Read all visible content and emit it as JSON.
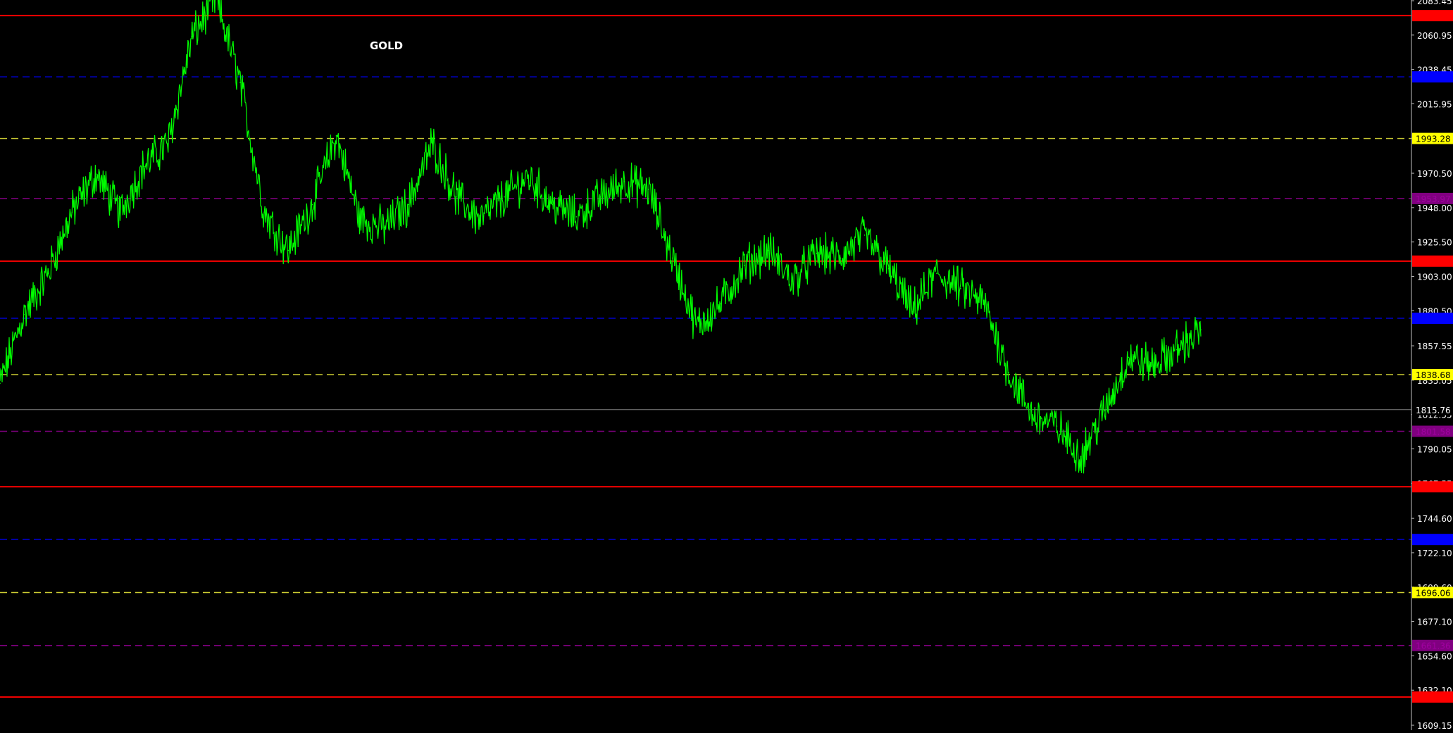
{
  "chart_data": {
    "type": "line",
    "title": "GOLD",
    "xlabel": "",
    "ylabel": "",
    "ylim": [
      1609.15,
      2083.45
    ],
    "grid": false,
    "colors": {
      "background": "#000000",
      "price_line": "#00ff00",
      "axis_text": "#ffffff",
      "axis_line": "#c0c0c0",
      "current_price_line": "#808080"
    },
    "y_tick_labels": [
      "2083.45",
      "2060.95",
      "2038.45",
      "2015.95",
      "1993.45",
      "1970.50",
      "1948.00",
      "1925.50",
      "1903.00",
      "1880.50",
      "1857.55",
      "1835.05",
      "1812.55",
      "1790.05",
      "1767.55",
      "1744.60",
      "1722.10",
      "1699.60",
      "1677.10",
      "1654.60",
      "1632.10",
      "1609.15"
    ],
    "current_price": {
      "label": "1815.76",
      "value": 1815.76,
      "bg": "#000000",
      "fg": "#ffffff"
    },
    "level_lines": [
      {
        "label": "2073.70",
        "value": 2073.7,
        "color": "#ff0000",
        "fg": "#ff0000",
        "bg": "#ff0000",
        "style": "solid"
      },
      {
        "label": "2033.59",
        "value": 2033.59,
        "color": "#0000cc",
        "fg": "#0000ff",
        "bg": "#0000ff",
        "style": "dashed"
      },
      {
        "label": "1993.28",
        "value": 1993.28,
        "color": "#cccc33",
        "fg": "#000000",
        "bg": "#ffff00",
        "style": "dashed"
      },
      {
        "label": "1953.97",
        "value": 1953.97,
        "color": "#800080",
        "fg": "#a000a0",
        "bg": "#800080",
        "style": "dashed"
      },
      {
        "label": "1912.98",
        "value": 1912.98,
        "color": "#ff0000",
        "fg": "#ff0000",
        "bg": "#ff0000",
        "style": "solid"
      },
      {
        "label": "1875.57",
        "value": 1875.57,
        "color": "#0000cc",
        "fg": "#0000ff",
        "bg": "#0000ff",
        "style": "dashed"
      },
      {
        "label": "1838.68",
        "value": 1838.68,
        "color": "#cccc33",
        "fg": "#000000",
        "bg": "#ffff00",
        "style": "dashed"
      },
      {
        "label": "1801.58",
        "value": 1801.58,
        "color": "#800080",
        "fg": "#a000a0",
        "bg": "#800080",
        "style": "dashed"
      },
      {
        "label": "1765.29",
        "value": 1765.29,
        "color": "#ff0000",
        "fg": "#ff0000",
        "bg": "#ff0000",
        "style": "solid"
      },
      {
        "label": "1730.76",
        "value": 1730.76,
        "color": "#0000cc",
        "fg": "#0000ff",
        "bg": "#0000ff",
        "style": "dashed"
      },
      {
        "label": "1696.06",
        "value": 1696.06,
        "color": "#cccc33",
        "fg": "#000000",
        "bg": "#ffff00",
        "style": "dashed"
      },
      {
        "label": "1661.36",
        "value": 1661.36,
        "color": "#800080",
        "fg": "#a000a0",
        "bg": "#800080",
        "style": "dashed"
      },
      {
        "label": "1627.64",
        "value": 1627.64,
        "color": "#ff0000",
        "fg": "#ff0000",
        "bg": "#ff0000",
        "style": "solid"
      }
    ],
    "series": [
      {
        "name": "",
        "color": "#00ff00",
        "x": [
          0,
          2,
          4,
          6,
          8,
          10,
          12,
          14,
          16,
          18,
          20,
          22,
          24,
          26,
          28,
          30,
          32,
          34,
          36,
          38,
          40,
          42,
          44,
          46,
          48,
          50,
          52,
          54,
          56,
          58,
          60,
          62,
          64,
          66,
          68,
          70,
          72,
          74,
          76,
          78,
          80,
          82,
          84,
          86,
          88,
          90,
          92,
          94,
          96,
          98,
          100
        ],
        "y": [
          1833,
          1878,
          1905,
          1945,
          1970,
          1945,
          1975,
          1990,
          2060,
          2085,
          2030,
          1945,
          1920,
          1950,
          1995,
          1940,
          1935,
          1950,
          1990,
          1955,
          1940,
          1955,
          1968,
          1950,
          1942,
          1955,
          1965,
          1960,
          1915,
          1870,
          1885,
          1910,
          1920,
          1900,
          1918,
          1915,
          1930,
          1908,
          1880,
          1905,
          1895,
          1885,
          1840,
          1812,
          1805,
          1785,
          1815,
          1850,
          1845,
          1855,
          1868
        ]
      }
    ]
  }
}
